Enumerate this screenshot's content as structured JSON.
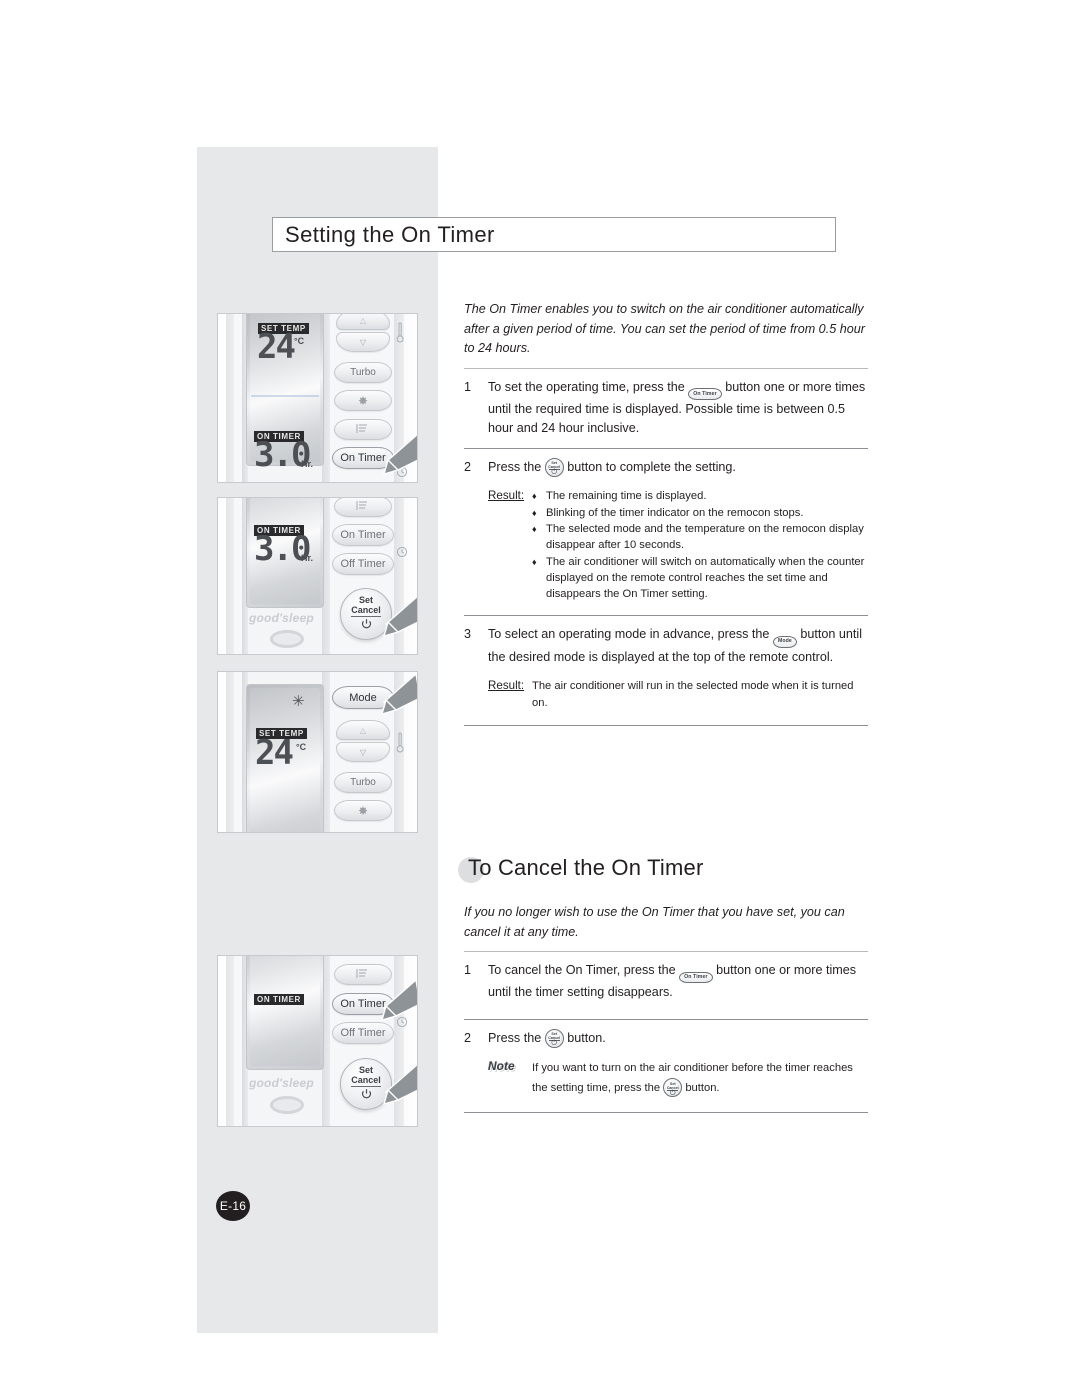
{
  "page": {
    "number": "E-16",
    "title": "Setting the On Timer"
  },
  "intro": "The On Timer enables you to switch on the air conditioner automatically after a given period of time. You can set the period of time from 0.5 hour to 24 hours.",
  "steps": [
    {
      "num": "1",
      "text_before": "To set the operating time, press the",
      "button": "On Timer",
      "text_after": "button one or more times until the required time is displayed. Possible time is between 0.5 hour and 24 hour inclusive."
    },
    {
      "num": "2",
      "text_before": "Press the",
      "button": "Set/Cancel",
      "text_after": "button to complete the setting.",
      "result_label": "Result:",
      "result_items": [
        "The remaining time is displayed.",
        "Blinking of the timer indicator on the remocon stops.",
        "The selected mode and the temperature on the remocon display disappear after 10 seconds.",
        "The air conditioner will switch on automatically when the counter displayed on the remote control reaches the set time and disappears the On Timer setting."
      ]
    },
    {
      "num": "3",
      "text_before": "To select an operating mode in advance, press the",
      "button": "Mode",
      "text_after": "button until the desired mode is displayed at the top of the remote control.",
      "result_label": "Result:",
      "result_text": "The air conditioner will run in the selected mode when it is turned on."
    }
  ],
  "section2": {
    "heading": "To Cancel the On Timer",
    "intro": "If you no longer wish to use the On Timer that you have set, you can cancel it at any time.",
    "steps": [
      {
        "num": "1",
        "text_before": "To cancel the On Timer, press the",
        "button": "On Timer",
        "text_after": "button one or more times until the timer setting disappears."
      },
      {
        "num": "2",
        "text_before": "Press the",
        "button": "Set/Cancel",
        "text_after": "button.",
        "note_label": "Note",
        "note_before": "If you want to turn on the air conditioner before the timer reaches the setting time, press the",
        "note_button": "Set/Cancel",
        "note_after": "button."
      }
    ]
  },
  "illustrations": [
    {
      "id": "panel-1",
      "lcd": {
        "set_temp_tag": "SET TEMP",
        "temperature": "24",
        "temp_unit": "°C",
        "timer_tag": "ON TIMER",
        "timer_value": "3.0",
        "timer_unit": "Hr."
      },
      "buttons": [
        "Turbo",
        "On Timer"
      ],
      "highlight": "On Timer"
    },
    {
      "id": "panel-2",
      "lcd": {
        "timer_tag": "ON TIMER",
        "timer_value": "3.0",
        "timer_unit": "Hr.",
        "brand": "good'sleep"
      },
      "buttons": [
        "On Timer",
        "Off Timer",
        "Set",
        "Cancel"
      ],
      "highlight": "Set/Cancel"
    },
    {
      "id": "panel-3",
      "lcd": {
        "set_temp_tag": "SET TEMP",
        "temperature": "24",
        "temp_unit": "°C",
        "mode_icon": "snowflake"
      },
      "buttons": [
        "Mode",
        "Turbo"
      ],
      "highlight": "Mode"
    },
    {
      "id": "panel-4",
      "lcd": {
        "timer_tag": "ON TIMER",
        "brand": "good'sleep"
      },
      "buttons": [
        "On Timer",
        "Off Timer",
        "Set",
        "Cancel"
      ],
      "highlight": "On Timer, Set/Cancel"
    }
  ],
  "colors": {
    "sidebar_bg": "#e6e8e9",
    "text": "#231f20",
    "rule": "#8c9094",
    "page_badge_bg": "#231f20",
    "lcd_tag_bg": "#2a2a2c"
  },
  "glyphs": {
    "snowflake": "✳",
    "diamond": "♦",
    "power": "⏻",
    "thermometer": "🌡",
    "fan": "❈",
    "clock": "🕒",
    "chevron_up": "△",
    "chevron_down": "▽",
    "swing": "↯"
  }
}
